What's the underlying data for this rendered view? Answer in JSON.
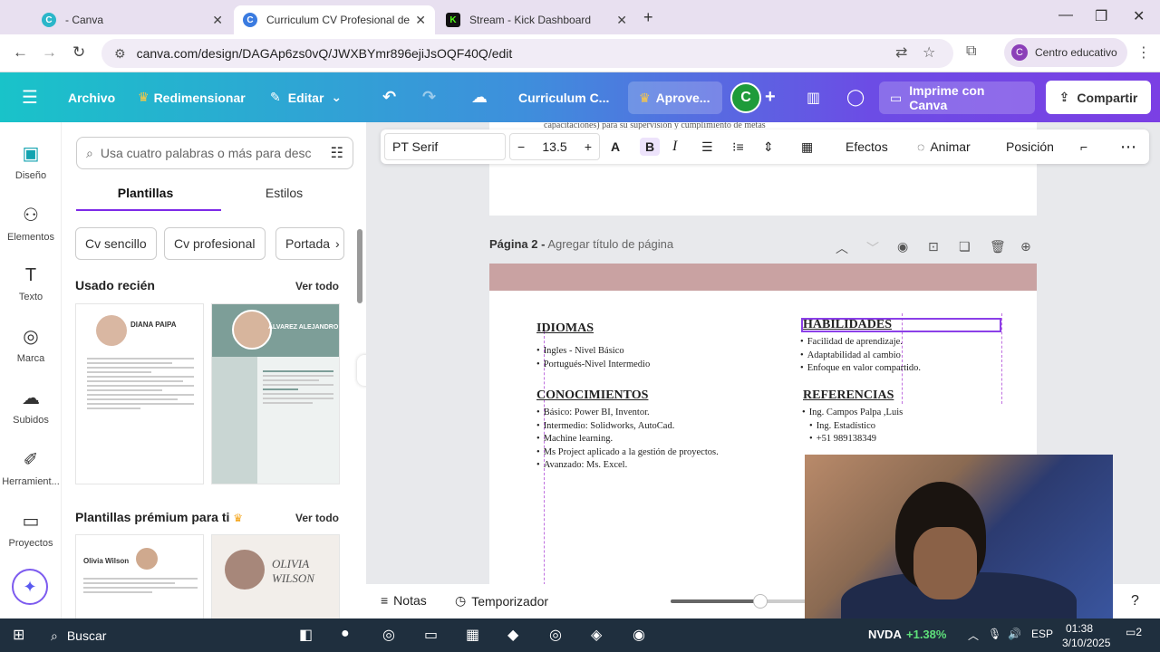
{
  "browser": {
    "tabs": [
      {
        "title": "- Canva",
        "active": false
      },
      {
        "title": "Curriculum CV Profesional de M",
        "active": true
      },
      {
        "title": "Stream - Kick Dashboard",
        "active": false
      }
    ],
    "url": "canva.com/design/DAGAp6zs0vQ/JWXBYmr896ejiJsOQF40Q/edit",
    "profile_label": "Centro educativo",
    "profile_initial": "C"
  },
  "canva_header": {
    "archivo": "Archivo",
    "redimensionar": "Redimensionar",
    "editar": "Editar",
    "doc_title": "Curriculum C...",
    "aprovechar": "Aprove...",
    "avatar_initial": "C",
    "imprime": "Imprime con Canva",
    "compartir": "Compartir"
  },
  "rail": [
    {
      "label": "Diseño",
      "icon": "design-icon"
    },
    {
      "label": "Elementos",
      "icon": "elements-icon"
    },
    {
      "label": "Texto",
      "icon": "text-icon"
    },
    {
      "label": "Marca",
      "icon": "brand-icon"
    },
    {
      "label": "Subidos",
      "icon": "upload-icon"
    },
    {
      "label": "Herramient...",
      "icon": "tools-icon"
    },
    {
      "label": "Proyectos",
      "icon": "folder-icon"
    }
  ],
  "panel": {
    "search_placeholder": "Usa cuatro palabras o más para desc",
    "tabs": [
      "Plantillas",
      "Estilos"
    ],
    "chips": [
      "Cv sencillo",
      "Cv profesional",
      "Portada"
    ],
    "recent_title": "Usado recién",
    "premium_title": "Plantillas prémium para ti",
    "see_all": "Ver todo",
    "thumb1_name": "DIANA PAIPA",
    "thumb2_name": "ÁLVAREZ ALEJANDRO",
    "thumb3_name": "Olivia Wilson",
    "thumb4_name": "OLIVIA WILSON"
  },
  "toolbar": {
    "font": "PT Serif",
    "size": "13.5",
    "efectos": "Efectos",
    "animar": "Animar",
    "posicion": "Posición"
  },
  "page1_cut": "capacitaciones) para su supervisión y cumplimiento de metas",
  "page2": {
    "label": "Página 2 -",
    "title_placeholder": "Agregar título de página",
    "idiomas": {
      "title": "IDIOMAS",
      "items": [
        "Ingles - Nivel Básico",
        "Portugués-Nivel Intermedio"
      ]
    },
    "conocimientos": {
      "title": "CONOCIMIENTOS",
      "items": [
        "Básico: Power BI, Inventor.",
        "Intermedio: Solidworks, AutoCad.",
        "Machine learning.",
        "Ms Project aplicado a la gestión de proyectos.",
        "Avanzado: Ms. Excel."
      ]
    },
    "habilidades": {
      "title": "HABILIDADES",
      "items": [
        "Facilidad de aprendizaje.",
        "Adaptabilidad al cambio",
        "Enfoque en valor compartido."
      ]
    },
    "referencias": {
      "title": "REFERENCIAS",
      "lines": [
        "Ing. Campos Palpa ,Luis",
        "Ing. Estadístico",
        "+51 989138349"
      ]
    }
  },
  "bottom": {
    "notas": "Notas",
    "temporizador": "Temporizador",
    "zoom_fraction": 0.66
  },
  "taskbar": {
    "search": "Buscar",
    "stock": "NVDA",
    "stock_change": "+1.38%",
    "lang": "ESP",
    "time": "01:38",
    "date": "3/10/2025",
    "notif": "2"
  },
  "colors": {
    "accent": "#7d2ae8",
    "band": "#c9a2a2"
  }
}
